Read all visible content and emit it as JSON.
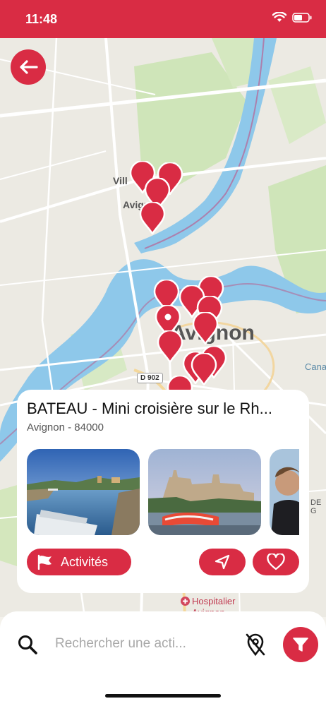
{
  "status_bar": {
    "time": "11:48"
  },
  "map": {
    "labels": {
      "villeneuve_1": "Vill",
      "villeneuve_2": "Avignon",
      "avignon": "Avignon",
      "canal": "Cana",
      "road_d902": "D 902",
      "deg": "DE G",
      "hospital_1": "Hospitalier",
      "hospital_2": "Avignon"
    }
  },
  "card": {
    "title": "BATEAU - Mini croisière sur le  Rh...",
    "subtitle": "Avignon - 84000",
    "category_label": "Activités"
  },
  "search": {
    "placeholder": "Rechercher une acti..."
  },
  "colors": {
    "accent": "#d92c44"
  },
  "icons": {
    "back": "arrow-left-icon",
    "category": "flag-icon",
    "navigate": "navigation-arrow-icon",
    "favorite": "heart-icon",
    "search": "search-icon",
    "no_location": "location-off-icon",
    "filter": "filter-funnel-icon"
  }
}
